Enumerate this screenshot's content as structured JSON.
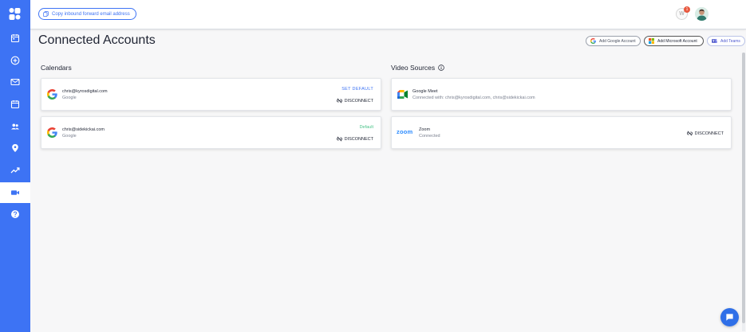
{
  "topbar": {
    "copy_email_label": "Copy inbound forward email address",
    "notification_count": "1",
    "notification_initial": "W"
  },
  "header": {
    "title": "Connected Accounts",
    "buttons": {
      "google": "Add Google Account",
      "microsoft": "Add Microsoft Account",
      "teams": "Add Teams"
    }
  },
  "calendars": {
    "title": "Calendars",
    "items": [
      {
        "email": "chris@kyrosdigital.com",
        "provider": "Google",
        "action": "SET DEFAULT",
        "disconnect": "DISCONNECT"
      },
      {
        "email": "chris@sidekickai.com",
        "provider": "Google",
        "action": "Default",
        "disconnect": "DISCONNECT"
      }
    ]
  },
  "video_sources": {
    "title": "Video Sources",
    "items": [
      {
        "name": "Google Meet",
        "status": "Connected with: chris@kyrosdigital.com, chris@sidekickai.com"
      },
      {
        "name": "Zoom",
        "logo_text": "zoom",
        "status": "Connected",
        "disconnect": "DISCONNECT"
      }
    ]
  },
  "sidebar": {
    "items": [
      {
        "icon": "calendar-check-icon"
      },
      {
        "icon": "add-circle-icon"
      },
      {
        "icon": "mail-icon"
      },
      {
        "icon": "calendar-icon"
      },
      {
        "icon": "people-icon"
      },
      {
        "icon": "location-pin-icon"
      },
      {
        "icon": "trending-up-icon"
      },
      {
        "icon": "video-camera-icon",
        "active": true
      },
      {
        "icon": "help-icon"
      }
    ]
  },
  "colors": {
    "primary": "#3d73f4",
    "default_green": "#4cc38a",
    "set_default_blue": "#3d73f4"
  }
}
